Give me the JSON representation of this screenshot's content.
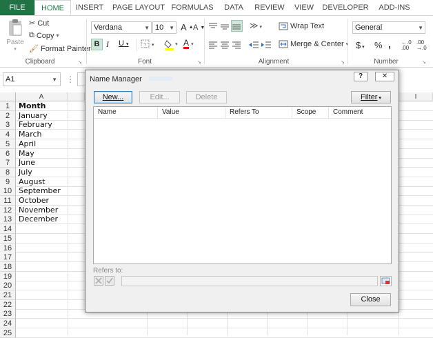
{
  "ribbon_tabs": [
    "FILE",
    "HOME",
    "INSERT",
    "PAGE LAYOUT",
    "FORMULAS",
    "DATA",
    "REVIEW",
    "VIEW",
    "DEVELOPER",
    "ADD-INS"
  ],
  "clipboard": {
    "paste": "Paste",
    "cut": "Cut",
    "copy": "Copy",
    "format_painter": "Format Painter",
    "label": "Clipboard"
  },
  "font": {
    "name": "Verdana",
    "size": "10",
    "bold": "B",
    "italic": "I",
    "underline": "U",
    "grow": "A",
    "shrink": "A",
    "font_color_glyph": "A",
    "label": "Font",
    "highlight_color": "#ffff00",
    "font_color": "#ff0000"
  },
  "alignment": {
    "wrap_text": "Wrap Text",
    "merge_center": "Merge & Center",
    "label": "Alignment"
  },
  "number": {
    "format": "General",
    "currency": "$",
    "percent": "%",
    "comma": ",",
    "label": "Number"
  },
  "formula_bar": {
    "name_box": "A1",
    "cancel_enter": "⋮"
  },
  "sheet": {
    "column_a": "A",
    "column_i": "I",
    "rows": [
      "1",
      "2",
      "3",
      "4",
      "5",
      "6",
      "7",
      "8",
      "9",
      "10",
      "11",
      "12",
      "13",
      "14",
      "15",
      "16",
      "17",
      "18",
      "19",
      "20",
      "21",
      "22",
      "23",
      "24",
      "25"
    ],
    "cells": [
      "Month",
      "January",
      "February",
      "March",
      "April",
      "May",
      "June",
      "July",
      "August",
      "September",
      "October",
      "November",
      "December"
    ]
  },
  "dialog": {
    "title": "Name Manager",
    "help": "?",
    "close_x": "✕",
    "new_button": "New...",
    "edit_button": "Edit...",
    "delete_button": "Delete",
    "filter_button": "Filter",
    "columns": [
      "Name",
      "Value",
      "Refers To",
      "Scope",
      "Comment"
    ],
    "refers_to_label": "Refers to:",
    "close_button": "Close"
  },
  "colors": {
    "file_tab": "#217346",
    "accent": "#217346"
  }
}
